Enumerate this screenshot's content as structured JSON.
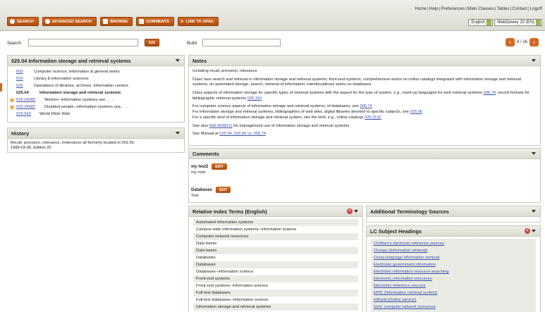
{
  "toplinks": [
    "Home",
    "Help",
    "Preferences",
    "Main Classes",
    "Tables",
    "Contact",
    "Logoff"
  ],
  "nav": {
    "search": "SEARCH",
    "advanced": "ADVANCED SEARCH",
    "browse": "BROWSE",
    "comments": "COMMENTS",
    "opac": "LINK TO OPAC"
  },
  "lang": {
    "language": "English",
    "edition": "WebDewey 23 (EN)"
  },
  "search": {
    "label": "Search",
    "value": "",
    "go": "GO",
    "build_label": "Build",
    "build_value": ""
  },
  "pager": {
    "text": "4 / 16"
  },
  "hierarchy": {
    "title": "025.04 Information storage and retrieval systems",
    "rows": [
      {
        "code": "000",
        "label": "Computer science, information & general works"
      },
      {
        "code": "020",
        "label": "Library & information sciences"
      },
      {
        "code": "025",
        "label": "Operations of libraries, archives, information centers"
      },
      {
        "code": "025.04",
        "label": "Information storage and retrieval systems"
      },
      {
        "code": "025.04082",
        "label": "Women--information systems use, . . ."
      },
      {
        "code": "025.04087",
        "label": "Disabled people--information systems use, . . ."
      },
      {
        "code": "025.042",
        "label": "World Wide Web"
      }
    ]
  },
  "history": {
    "title": "History",
    "lines": [
      "Recall, precision, relevance, irrelevance all formerly located in 001.59",
      "1989-03-06, Edition 20"
    ]
  },
  "notes": {
    "title": "Notes",
    "p1": "Including recall, precision, relevance",
    "p2": "Class here search and retrieval in information storage and retrieval systems; front-end systems, comprehensive works on online catalogs integrated with information storage and retrieval systems, on automated storage, search, retrieval of information; interdisciplinary works on databases",
    "p3a": "Class aspects of information storage for specific types of retrieval systems with the aspect for the type of system, e.g., mark-up languages for web retrieval systems",
    "p3link1": "006.74",
    "p3b": "; record formats for bibliographic retrieval systems",
    "p3link2": "025.316",
    "p4a": "For computer science aspects of information storage and retrieval systems, of databases, see",
    "p4link1": "005.74",
    "p4b": "For information storage and retrieval systems, bibliographies of web sites, digital libraries devoted to specific subjects, see",
    "p4link2": "025.06",
    "p4c": "For a specific kind of information storage and retrieval system, see the kind, e.g., online catalogs",
    "p4link3": "025.3132",
    "p5a": "See also",
    "p5link": "658.4038011",
    "p5b": "for management use of information storage and retrieval systems",
    "p6a": "See Manual at",
    "p6link": "025.04, 025.06 vs. 005.74"
  },
  "comments": {
    "title": "Comments",
    "items": [
      {
        "name": "my test2",
        "edit": "EDIT",
        "text": "my note"
      },
      {
        "name": "Databases",
        "edit": "EDIT",
        "text": "Test"
      }
    ]
  },
  "relindex": {
    "title": "Relative Index Terms (English)",
    "items": [
      "Automated information systems",
      "Campus-wide information systems--information science",
      "Computer network resources",
      "Data banks",
      "Data bases",
      "Databanks",
      "Databases",
      "Databases--information science",
      "Front-end systems",
      "Front-end systems--information science",
      "Full-text databases",
      "Full-text databases--information science",
      "Information storage and retrieval systems"
    ]
  },
  "addterm": {
    "title": "Additional Terminology Sources"
  },
  "lcsh": {
    "title": "LC Subject Headings",
    "items": [
      "Children's electronic reference sources",
      "Clumps (Information retrieval)",
      "Cross-language information retrieval",
      "Electronic government information",
      "Electronic information resource searching",
      "Electronic information resources",
      "Electronic reference sources",
      "EPIC (Information retrieval system)",
      "eWorld (Online service)",
      "Girls' computer network resources"
    ]
  }
}
